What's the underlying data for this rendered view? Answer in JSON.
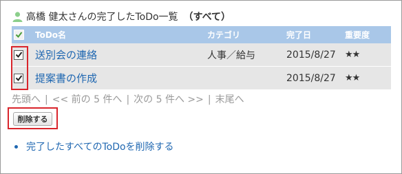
{
  "title": {
    "user_name": "高橋 健太",
    "suffix": " さんの完了したToDo一覧",
    "scope": "（すべて）"
  },
  "table": {
    "headers": {
      "name": "ToDo名",
      "category": "カテゴリ",
      "date": "完了日",
      "importance": "重要度"
    },
    "rows": [
      {
        "name": "送別会の連絡",
        "category": "人事／給与",
        "date": "2015/8/27",
        "importance": "★★",
        "checked": true
      },
      {
        "name": "提案書の作成",
        "category": "",
        "date": "2015/8/27",
        "importance": "★★",
        "checked": true
      }
    ]
  },
  "pager": {
    "first": "先頭へ",
    "prev": "<< 前の 5 件へ",
    "next": "次の 5 件へ >>",
    "last": "末尾へ",
    "separator": "|"
  },
  "delete_button": "削除する",
  "delete_all_link": "完了したすべてのToDoを削除する",
  "colors": {
    "header_bg": "#a9c7e8",
    "row_bg": "#e6e6e6",
    "link": "#1f67b1",
    "highlight": "#d9242b"
  }
}
